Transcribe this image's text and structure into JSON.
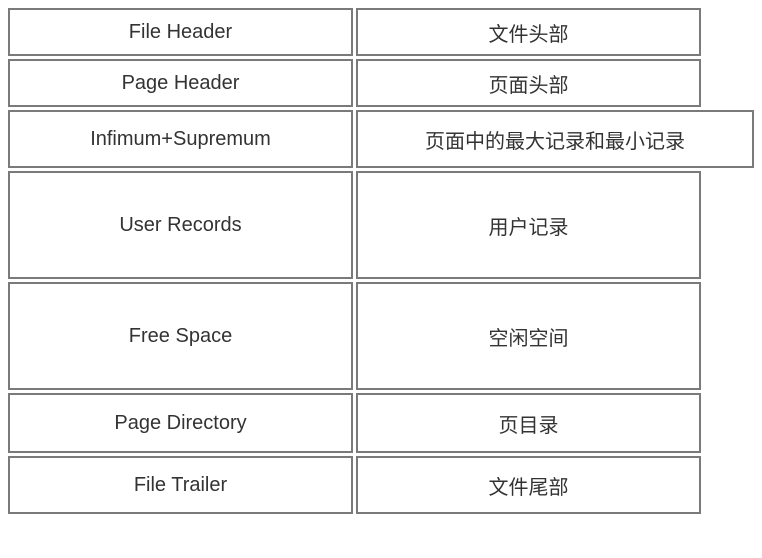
{
  "rows": [
    {
      "left": "File Header",
      "right": "文件头部"
    },
    {
      "left": "Page Header",
      "right": "页面头部"
    },
    {
      "left": "Infimum+Supremum",
      "right": "页面中的最大记录和最小记录"
    },
    {
      "left": "User Records",
      "right": "用户记录"
    },
    {
      "left": "Free Space",
      "right": "空闲空间"
    },
    {
      "left": "Page Directory",
      "right": "页目录"
    },
    {
      "left": "File Trailer",
      "right": "文件尾部"
    }
  ]
}
